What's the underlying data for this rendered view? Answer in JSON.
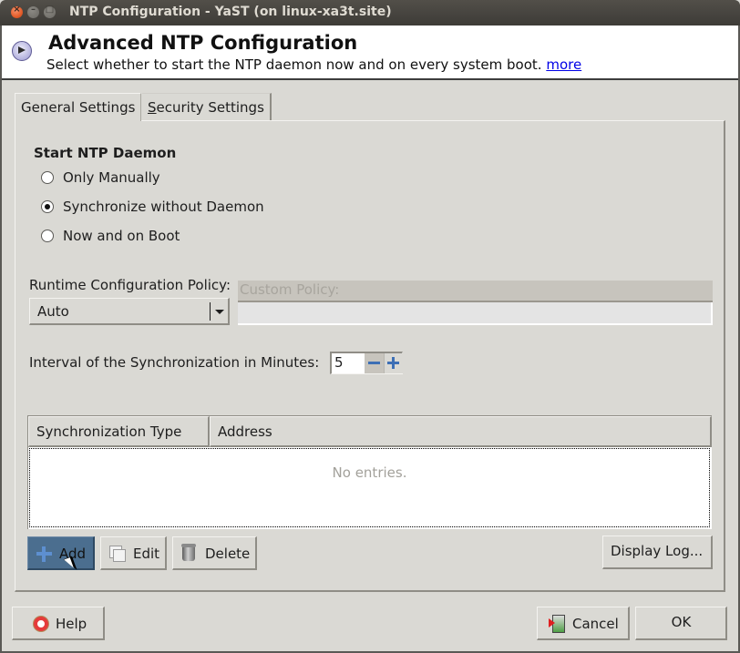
{
  "window": {
    "title": "NTP Configuration - YaST (on linux-xa3t.site)",
    "controls": [
      "close",
      "minimize",
      "maximize"
    ]
  },
  "header": {
    "icon": "ntp-clock-icon",
    "title": "Advanced NTP Configuration",
    "subtitle": "Select whether to start the NTP daemon now and on every system boot.",
    "more_link": "more"
  },
  "tabs": [
    {
      "label": "General Settings",
      "active": true
    },
    {
      "label_mnemonic": "S",
      "label_rest": "ecurity Settings",
      "active": false
    }
  ],
  "start_daemon": {
    "title": "Start NTP Daemon",
    "options": [
      {
        "label": "Only Manually",
        "checked": false
      },
      {
        "label": "Synchronize without Daemon",
        "checked": true
      },
      {
        "label": "Now and on Boot",
        "checked": false
      }
    ]
  },
  "policy": {
    "label": "Runtime Configuration Policy:",
    "selected": "Auto",
    "custom_label": "Custom Policy:",
    "custom_value": ""
  },
  "interval": {
    "label": "Interval of the Synchronization in Minutes:",
    "value": "5"
  },
  "table": {
    "columns": [
      "Synchronization Type",
      "Address"
    ],
    "rows": [],
    "empty_text": "No entries."
  },
  "table_buttons": {
    "add": "Add",
    "edit": "Edit",
    "delete": "Delete",
    "display_log": "Display Log..."
  },
  "footer": {
    "help": "Help",
    "cancel": "Cancel",
    "ok": "OK"
  }
}
